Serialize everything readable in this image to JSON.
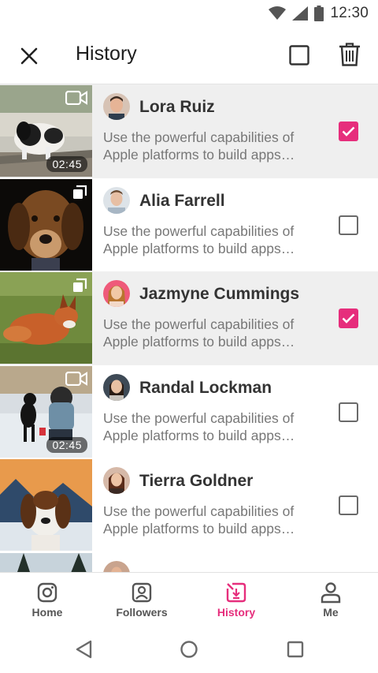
{
  "status_bar": {
    "time": "12:30",
    "icons": [
      "wifi-icon",
      "signal-icon",
      "battery-icon"
    ]
  },
  "header": {
    "title": "History",
    "icons": [
      "close-icon",
      "select-all-checkbox",
      "trash-icon"
    ]
  },
  "accent_color": "#e62e7c",
  "items": [
    {
      "name": "Lora Ruiz",
      "desc_line1": "Use the powerful capabilities of",
      "desc_line2": "Apple platforms to build apps…",
      "media_type": "video",
      "duration": "02:45",
      "checked": true
    },
    {
      "name": "Alia Farrell",
      "desc_line1": "Use the powerful capabilities of",
      "desc_line2": "Apple platforms to build apps…",
      "media_type": "gallery",
      "duration": "",
      "checked": false
    },
    {
      "name": "Jazmyne Cummings",
      "desc_line1": "Use the powerful capabilities of",
      "desc_line2": "Apple platforms to build apps…",
      "media_type": "gallery",
      "duration": "",
      "checked": true
    },
    {
      "name": "Randal Lockman",
      "desc_line1": "Use the powerful capabilities of",
      "desc_line2": "Apple platforms to build apps…",
      "media_type": "video",
      "duration": "02:45",
      "checked": false
    },
    {
      "name": "Tierra Goldner",
      "desc_line1": "Use the powerful capabilities of",
      "desc_line2": "Apple platforms to build apps…",
      "media_type": "none",
      "duration": "",
      "checked": false
    }
  ],
  "bottom_nav": [
    {
      "label": "Home",
      "icon": "instagram-icon",
      "active": false
    },
    {
      "label": "Followers",
      "icon": "followers-icon",
      "active": false
    },
    {
      "label": "History",
      "icon": "history-download-icon",
      "active": true
    },
    {
      "label": "Me",
      "icon": "person-icon",
      "active": false
    }
  ],
  "system_nav": [
    "back-icon",
    "home-icon",
    "recents-icon"
  ]
}
